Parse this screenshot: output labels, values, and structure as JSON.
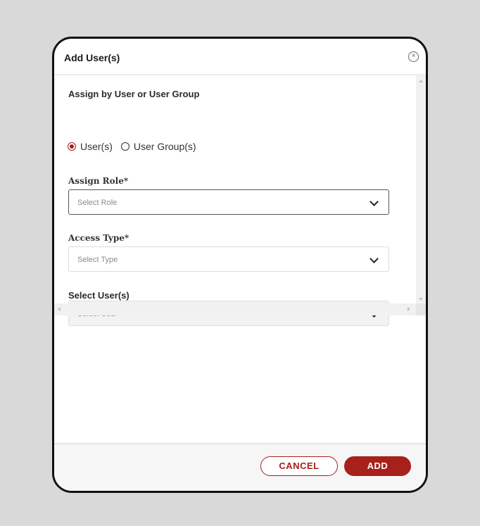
{
  "dialog": {
    "title": "Add User(s)",
    "close_icon": "close-circle-icon"
  },
  "assign_by": {
    "label": "Assign by User or User Group",
    "options": [
      {
        "label": "User(s)",
        "checked": true
      },
      {
        "label": "User Group(s)",
        "checked": false
      }
    ]
  },
  "fields": {
    "role": {
      "label": "Assign Role*",
      "placeholder": "Select Role"
    },
    "access": {
      "label": "Access Type*",
      "placeholder": "Select Type"
    },
    "users": {
      "label": "Select User(s)",
      "placeholder": "Select User"
    }
  },
  "footer": {
    "cancel_label": "CANCEL",
    "add_label": "ADD"
  },
  "colors": {
    "accent": "#a8201a",
    "backdrop": "#d9d9d9"
  }
}
